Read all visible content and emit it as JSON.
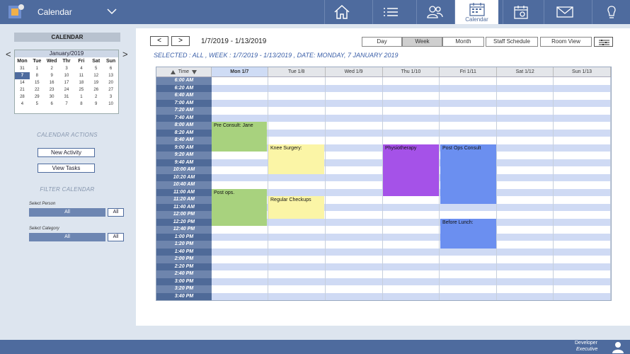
{
  "header": {
    "app_title": "Calendar",
    "nav": [
      {
        "icon": "home-icon"
      },
      {
        "icon": "list-icon"
      },
      {
        "icon": "users-icon"
      },
      {
        "icon": "calendar-icon",
        "label": "Calendar",
        "active": true
      },
      {
        "icon": "calendar-settings-icon"
      },
      {
        "icon": "mail-icon"
      },
      {
        "icon": "lightbulb-icon"
      }
    ]
  },
  "sidebar": {
    "calendar_title": "CALENDAR",
    "mini_calendar": {
      "month": "January/2019",
      "days_of_week": [
        "Mon",
        "Tue",
        "Wed",
        "Thr",
        "Fri",
        "Sat",
        "Sun"
      ],
      "weeks": [
        [
          "31",
          "1",
          "2",
          "3",
          "4",
          "5",
          "6"
        ],
        [
          "7",
          "8",
          "9",
          "10",
          "11",
          "12",
          "13"
        ],
        [
          "14",
          "15",
          "16",
          "17",
          "18",
          "19",
          "20"
        ],
        [
          "21",
          "22",
          "23",
          "24",
          "25",
          "26",
          "27"
        ],
        [
          "28",
          "29",
          "30",
          "31",
          "1",
          "2",
          "3"
        ],
        [
          "4",
          "5",
          "6",
          "7",
          "8",
          "9",
          "10"
        ]
      ],
      "selected": "7"
    },
    "actions_title": "CALENDAR ACTIONS",
    "new_activity": "New Activity",
    "view_tasks": "View Tasks",
    "filter_title": "FILTER CALENDAR",
    "person_label": "Select Person",
    "person_value": "All",
    "person_all_btn": "All",
    "category_label": "Select Category",
    "category_value": "All",
    "category_all_btn": "All"
  },
  "main": {
    "prev": "<",
    "next": ">",
    "range": "1/7/2019 - 1/13/2019",
    "views": [
      "Day",
      "Week",
      "Month",
      "Staff Schedule",
      "Room View"
    ],
    "active_view": "Week",
    "selected_line": "SELECTED : ALL , WEEK :  1/7/2019 - 1/13/2019 , DATE:  MONDAY, 7 JANUARY 2019",
    "time_header": "Time",
    "days": [
      "Mon 1/7",
      "Tue 1/8",
      "Wed 1/9",
      "Thu 1/10",
      "Fri 1/11",
      "Sat 1/12",
      "Sun 1/13"
    ],
    "times": [
      "6:00 AM",
      "6:20 AM",
      "6:40 AM",
      "7:00 AM",
      "7:20 AM",
      "7:40 AM",
      "8:00 AM",
      "8:20 AM",
      "8:40 AM",
      "9:00 AM",
      "9:20 AM",
      "9:40 AM",
      "10:00 AM",
      "10:20 AM",
      "10:40 AM",
      "11:00 AM",
      "11:20 AM",
      "11:40 AM",
      "12:00 PM",
      "12:20 PM",
      "12:40 PM",
      "1:00 PM",
      "1:20 PM",
      "1:40 PM",
      "2:00 PM",
      "2:20 PM",
      "2:40 PM",
      "3:00 PM",
      "3:20 PM",
      "3:40 PM"
    ],
    "events": [
      {
        "title": "Pre Consult: Jane",
        "day": 0,
        "start": 6,
        "slots": 4,
        "color": "#a8d27e"
      },
      {
        "title": "Knee Surgery:",
        "day": 1,
        "start": 9,
        "slots": 4,
        "color": "#fbf5a6"
      },
      {
        "title": "Physiotherapy",
        "day": 3,
        "start": 9,
        "slots": 7,
        "color": "#a552e8"
      },
      {
        "title": "Post Ops Consult",
        "day": 4,
        "start": 9,
        "slots": 8,
        "color": "#6b8ff0"
      },
      {
        "title": "Post ops.",
        "day": 0,
        "start": 15,
        "slots": 5,
        "color": "#a8d27e"
      },
      {
        "title": "Regular Checkups",
        "day": 1,
        "start": 16,
        "slots": 3,
        "color": "#fbf5a6"
      },
      {
        "title": "Before Lunch:",
        "day": 4,
        "start": 19,
        "slots": 4,
        "color": "#6b8ff0"
      }
    ]
  },
  "footer": {
    "user_name": "Developer",
    "user_role": "Executive"
  }
}
